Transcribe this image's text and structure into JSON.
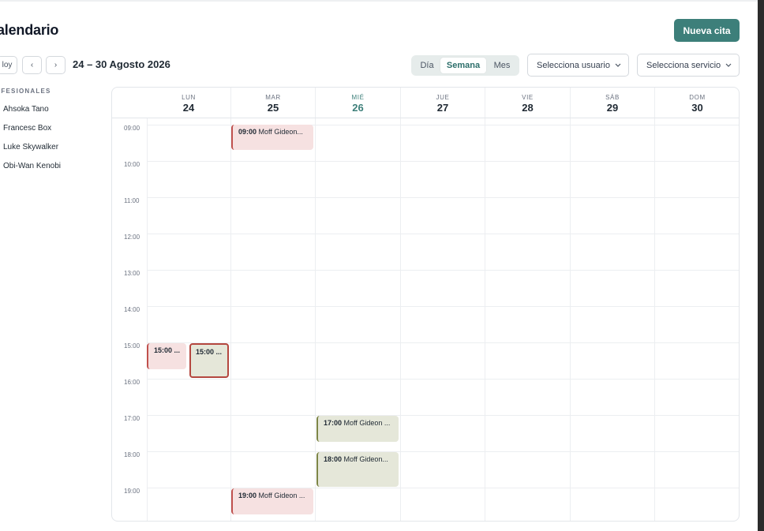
{
  "page": {
    "title": "alendario"
  },
  "toolbar": {
    "new_button": "Nueva cita",
    "today_button": "loy",
    "prev_icon": "‹",
    "next_icon": "›",
    "range": "24 – 30 Agosto 2026",
    "views": [
      "Día",
      "Semana",
      "Mes"
    ],
    "active_view": "Semana",
    "user_select": "Selecciona usuario",
    "service_select": "Selecciona servicio"
  },
  "sidebar": {
    "heading": "OFESIONALES",
    "items": [
      "Ahsoka Tano",
      "Francesc Box",
      "Luke Skywalker",
      "Obi-Wan Kenobi"
    ]
  },
  "calendar": {
    "days": [
      {
        "name": "LUN",
        "num": "24",
        "today": false
      },
      {
        "name": "MAR",
        "num": "25",
        "today": false
      },
      {
        "name": "MIÉ",
        "num": "26",
        "today": true
      },
      {
        "name": "JUE",
        "num": "27",
        "today": false
      },
      {
        "name": "VIE",
        "num": "28",
        "today": false
      },
      {
        "name": "SÁB",
        "num": "29",
        "today": false
      },
      {
        "name": "DOM",
        "num": "30",
        "today": false
      }
    ],
    "hours": [
      "09:00",
      "10:00",
      "11:00",
      "12:00",
      "13:00",
      "14:00",
      "15:00",
      "16:00",
      "17:00",
      "18:00",
      "19:00"
    ],
    "events": [
      {
        "time": "09:00",
        "title": "Moff Gideon...",
        "day": "MAR",
        "color": "#f6e1e1"
      },
      {
        "time": "15:00 ...",
        "title": "",
        "day": "LUN",
        "color": "#f6e1e1"
      },
      {
        "time": "15:00 ...",
        "title": "",
        "day": "LUN",
        "color": "#e5e7d9"
      },
      {
        "time": "17:00",
        "title": "Moff Gideon ...",
        "day": "MIÉ",
        "color": "#e5e7d9"
      },
      {
        "time": "18:00",
        "title": "Moff Gideon...",
        "day": "MIÉ",
        "color": "#e5e7d9"
      },
      {
        "time": "19:00",
        "title": "Moff Gideon ...",
        "day": "MAR",
        "color": "#f6e1e1"
      }
    ]
  },
  "colors": {
    "accent": "#3d7f7a",
    "event_red": "#f6e1e1",
    "event_olive": "#e5e7d9"
  }
}
